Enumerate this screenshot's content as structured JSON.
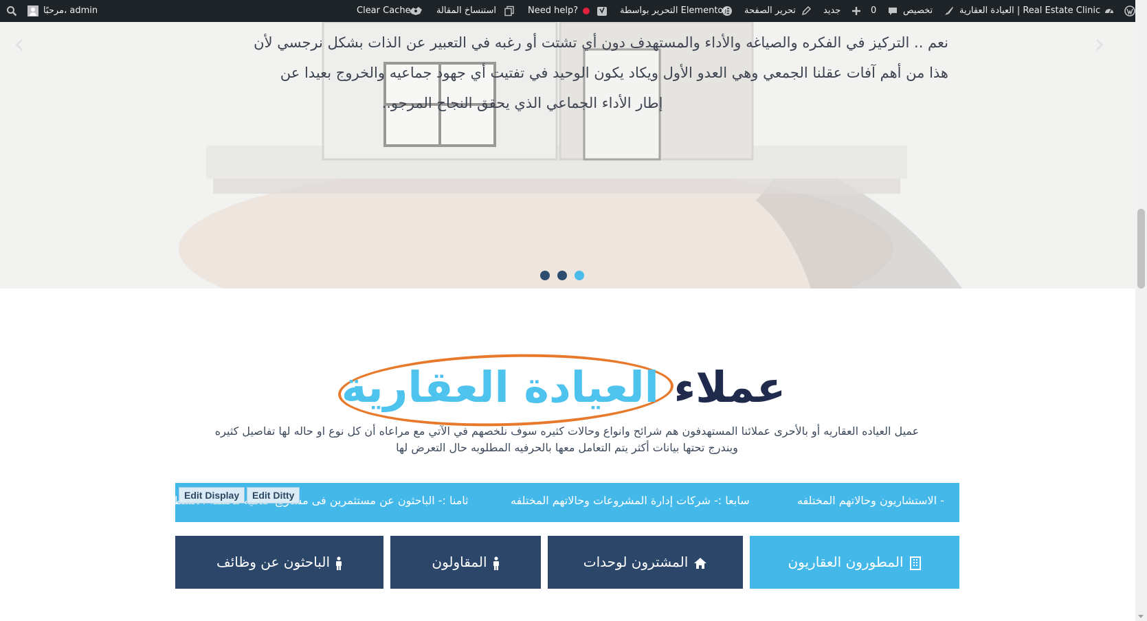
{
  "admin_bar": {
    "site_name": "العيادة العقارية | Real Estate Clinic",
    "customize": "تخصيص",
    "comments_count": "0",
    "new": "جديد",
    "edit_page": "تحرير الصفحة",
    "edit_elementor": "التحرير بواسطة Elementor",
    "need_help": "Need help?",
    "duplicate": "استنساخ المقالة",
    "clear_cache": "Clear Cache",
    "greeting": "مرحبًا، admin"
  },
  "hero": {
    "paragraph_lines": [
      "نعم .. التركيز في الفكره والصياغه والأداء والمستهدف دون أي تشتت أو رغبه في التعبير عن الذات بشكل نرجسي لأن",
      "هذا من أهم آفات عقلنا الجمعي وهي العدو الأول ويكاد يكون الوحيد في تفتيت أي جهود جماعيه والخروج بعيدا عن",
      "إطار الأداء الجماعي الذي يحقق النجاح المرجو.."
    ],
    "slide_count": 3,
    "active_slide": 3
  },
  "section": {
    "title_dark": "عملاء",
    "title_blue": "العيادة العقارية",
    "description_lines": [
      "عميل العياده العقاريه أو بالأحرى عملائنا المستهدفون هم شرائح وانواع وحالات كثيره سوف نلخصهم في الآتي مع مراعاه أن كل نوع او حاله لها تفاصيل كثيره",
      "ويندرج تحتها بيانات أكثر يتم التعامل معها بالحرفيه المطلوبه حال التعرض لها"
    ]
  },
  "ticker": {
    "items": [
      "- الاستشاريون وحالاتهم المختلفه",
      "سابعا :- شركات إدارة المشروعات وحالاتهم المختلفه",
      "ثامنا :- الباحثون عن مستثمرين فى مشاريع خدميه مختلفه الأنشطه"
    ],
    "edit_display": "Edit Display",
    "edit_ditty": "Edit Ditty"
  },
  "categories": [
    {
      "label": "المطورون العقاريون",
      "icon": "building-icon",
      "active": true
    },
    {
      "label": "المشترون لوحدات",
      "icon": "home-icon",
      "active": false
    },
    {
      "label": "المقاولون",
      "icon": "person-icon",
      "active": false
    },
    {
      "label": "الباحثون عن وظائف",
      "icon": "person-icon",
      "active": false
    }
  ],
  "colors": {
    "admin_bar": "#1d2327",
    "title_dark": "#1f2a4d",
    "accent_blue": "#45b8ea",
    "button_dark": "#2c466a",
    "ellipse_orange": "#e8792a"
  }
}
